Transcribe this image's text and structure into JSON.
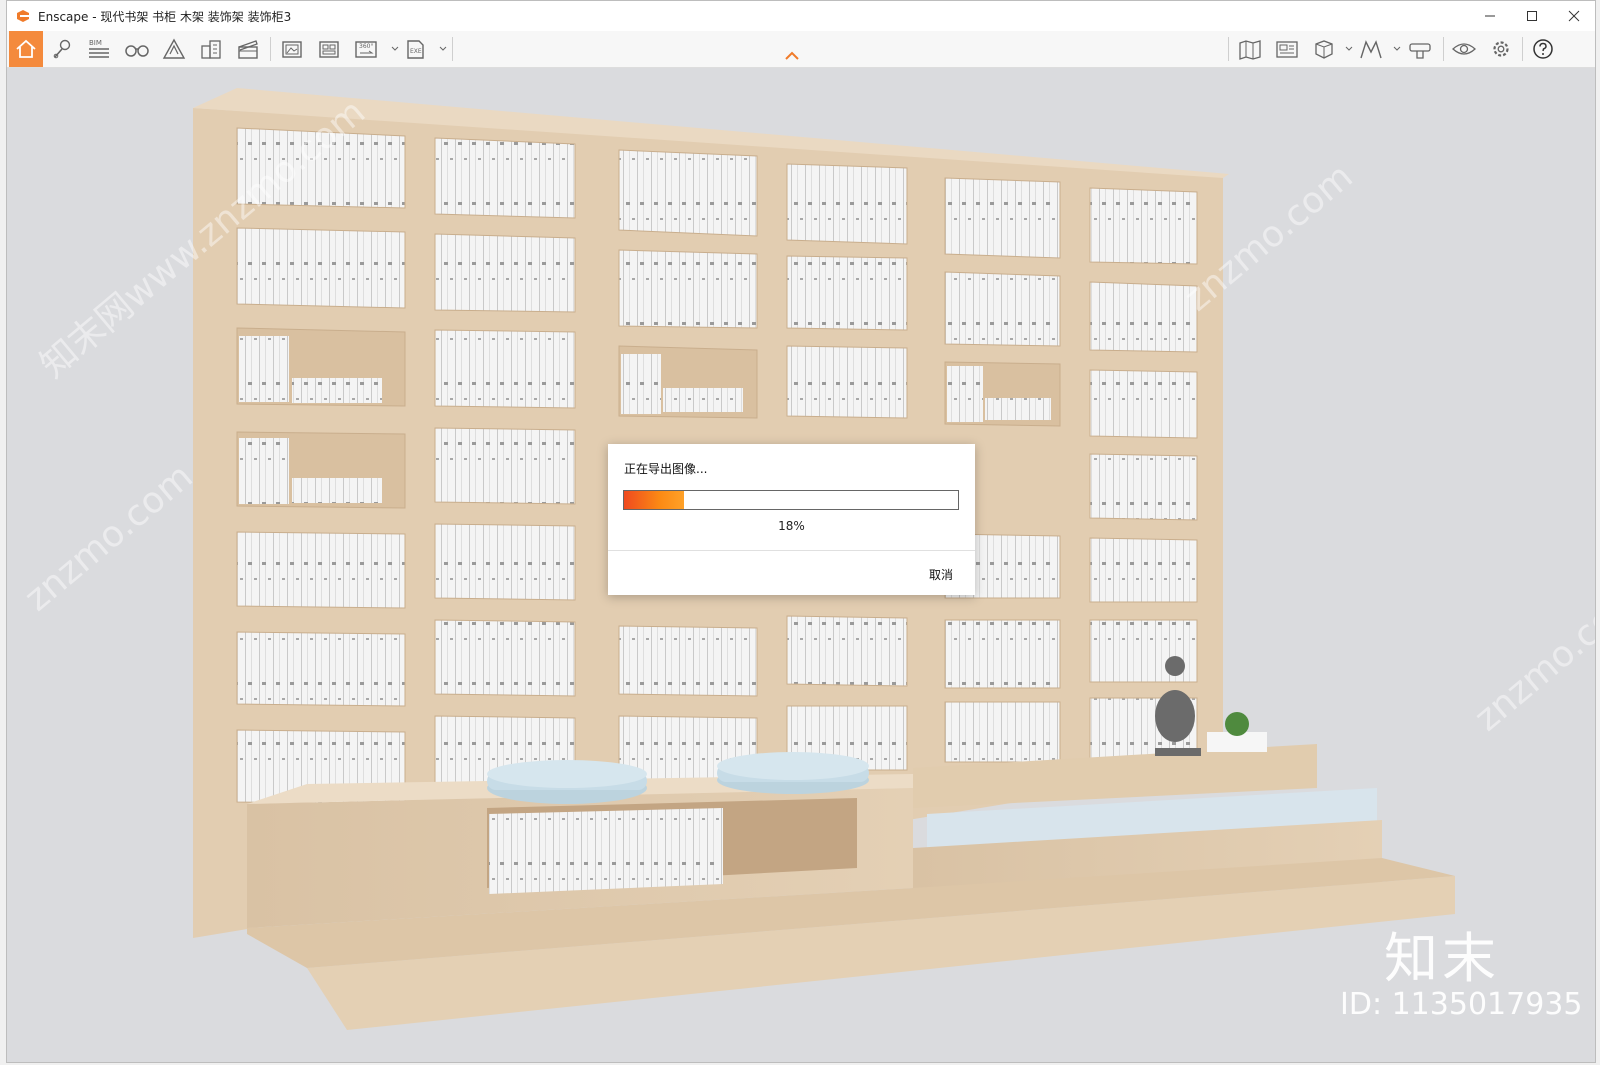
{
  "window": {
    "title": "Enscape - 现代书架 书柜 木架 装饰架 装饰柜3"
  },
  "colors": {
    "accent": "#f48a3c",
    "progress_start": "#ef4a1f",
    "progress_end": "#ffa128"
  },
  "toolbar": {
    "left_icons": [
      "home-icon",
      "asset-pin-icon",
      "bim-icon",
      "binoculars-icon",
      "sketch-mode-icon",
      "building-icon",
      "video-clapper-icon",
      "render-image-icon",
      "batch-render-icon",
      "render-360-icon",
      "export-exe-icon"
    ],
    "right_icons": [
      "map-icon",
      "views-icon",
      "cube-icon",
      "visual-settings-icon",
      "material-editor-icon",
      "visibility-icon",
      "settings-icon",
      "help-icon"
    ],
    "bim_label": "BIM",
    "pano_label": "360°",
    "exe_label": "EXE"
  },
  "dialog": {
    "title": "正在导出图像...",
    "progress_value": 18,
    "progress_text": "18%",
    "cancel_label": "取消"
  },
  "watermark": {
    "logo_text": "知末",
    "id_text": "ID: 1135017935",
    "site_text": "znzmo.com",
    "site_full": "知末网www.znzmo.com"
  }
}
